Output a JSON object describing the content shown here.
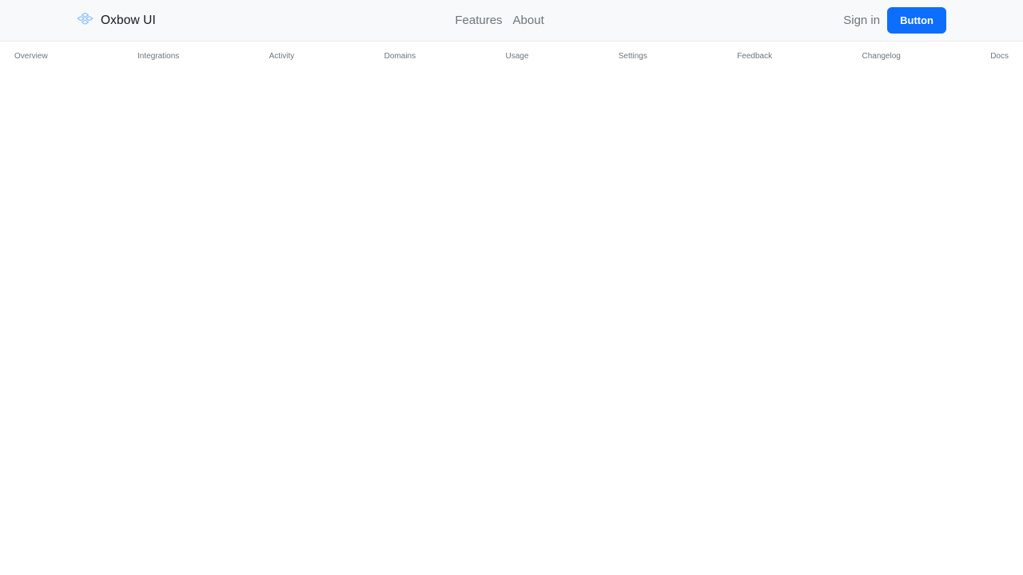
{
  "header": {
    "background_color": "#f8f9fa",
    "border_color": "#e7e9ec",
    "brand": {
      "icon": "stacked-boxes-icon",
      "icon_color": "#8ec5fb",
      "name": "Oxbow UI",
      "name_color": "#14171c"
    },
    "nav": [
      {
        "label": "Features"
      },
      {
        "label": "About"
      }
    ],
    "actions": {
      "signin_label": "Sign in",
      "button_label": "Button",
      "button_color": "#0d6efd",
      "button_text_color": "#ffffff"
    }
  },
  "secondary_nav": {
    "text_color": "#6c757d",
    "items": [
      {
        "label": "Overview"
      },
      {
        "label": "Integrations"
      },
      {
        "label": "Activity"
      },
      {
        "label": "Domains"
      },
      {
        "label": "Usage"
      },
      {
        "label": "Settings"
      },
      {
        "label": "Feedback"
      },
      {
        "label": "Changelog"
      },
      {
        "label": "Docs"
      }
    ]
  },
  "body": {
    "background_color": "#ffffff"
  }
}
